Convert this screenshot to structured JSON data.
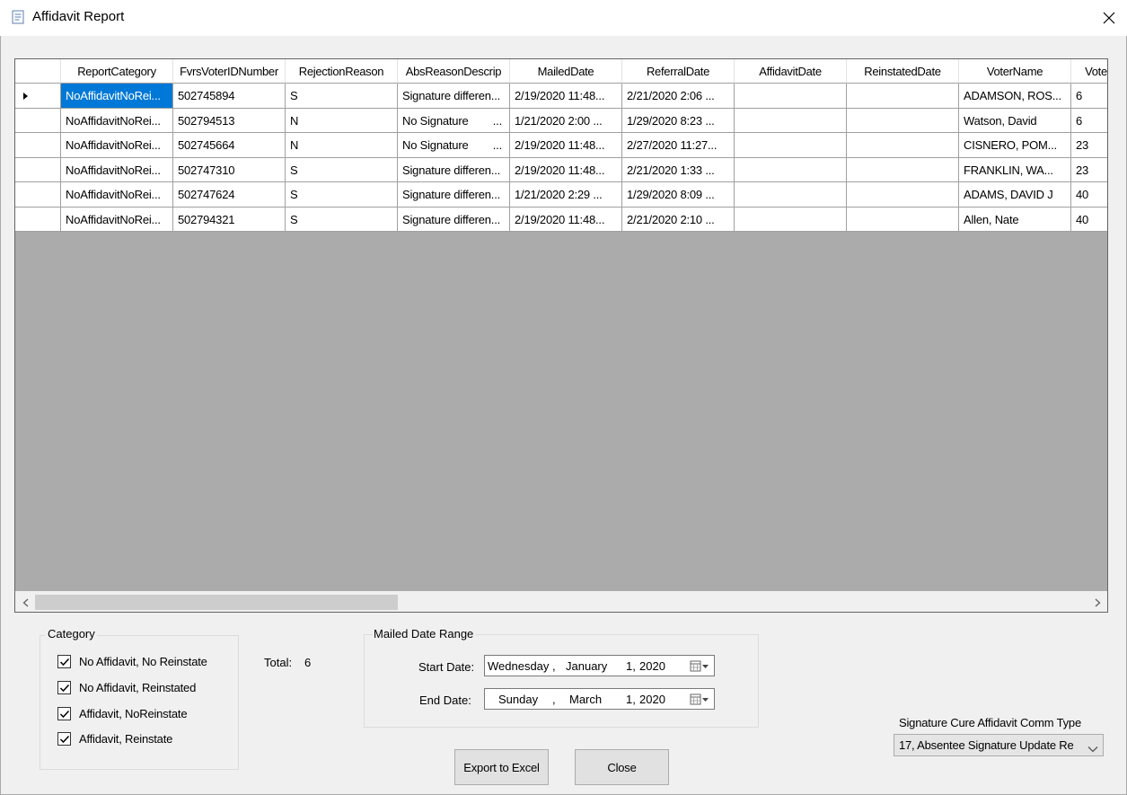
{
  "window": {
    "title": "Affidavit Report",
    "icon": "document-report-icon"
  },
  "grid": {
    "columns": [
      "ReportCategory",
      "FvrsVoterIDNumber",
      "RejectionReason",
      "AbsReasonDescrip",
      "MailedDate",
      "ReferralDate",
      "AffidavitDate",
      "ReinstatedDate",
      "VoterName",
      "Voter"
    ],
    "rows": [
      [
        "NoAffidavitNoRei...",
        "502745894",
        "S",
        "Signature differen...",
        "2/19/2020 11:48...",
        "2/21/2020 2:06 ...",
        "",
        "",
        "ADAMSON, ROS...",
        "6"
      ],
      [
        "NoAffidavitNoRei...",
        "502794513",
        "N",
        "No Signature        ...",
        "1/21/2020 2:00 ...",
        "1/29/2020 8:23 ...",
        "",
        "",
        "Watson, David",
        "6"
      ],
      [
        "NoAffidavitNoRei...",
        "502745664",
        "N",
        "No Signature        ...",
        "2/19/2020 11:48...",
        "2/27/2020 11:27...",
        "",
        "",
        "CISNERO, POM...",
        "23"
      ],
      [
        "NoAffidavitNoRei...",
        "502747310",
        "S",
        "Signature differen...",
        "2/19/2020 11:48...",
        "2/21/2020 1:33 ...",
        "",
        "",
        "FRANKLIN, WA...",
        "23"
      ],
      [
        "NoAffidavitNoRei...",
        "502747624",
        "S",
        "Signature differen...",
        "1/21/2020 2:29 ...",
        "1/29/2020 8:09 ...",
        "",
        "",
        "ADAMS, DAVID J",
        "40"
      ],
      [
        "NoAffidavitNoRei...",
        "502794321",
        "S",
        "Signature differen...",
        "2/19/2020 11:48...",
        "2/21/2020 2:10 ...",
        "",
        "",
        "Allen, Nate",
        "40"
      ]
    ]
  },
  "category": {
    "title": "Category",
    "options": [
      {
        "label": "No Affidavit, No Reinstate",
        "checked": true
      },
      {
        "label": "No Affidavit, Reinstated",
        "checked": true
      },
      {
        "label": "Affidavit, NoReinstate",
        "checked": true
      },
      {
        "label": "Affidavit, Reinstate",
        "checked": true
      }
    ]
  },
  "total": {
    "label": "Total:",
    "value": "6"
  },
  "mailed_range": {
    "title": "Mailed Date Range",
    "start_label": "Start Date:",
    "start": {
      "weekday": "Wednesday",
      "sep1": ",",
      "month": "January",
      "day": "1,",
      "year": "2020"
    },
    "end_label": "End Date:",
    "end": {
      "weekday": "Sunday",
      "sep1": ",",
      "month": "March",
      "day": "1,",
      "year": "2020"
    }
  },
  "buttons": {
    "export": "Export to Excel",
    "close": "Close"
  },
  "comm_type": {
    "label": "Signature Cure Affidavit Comm Type",
    "value": "17, Absentee Signature Update Re"
  }
}
